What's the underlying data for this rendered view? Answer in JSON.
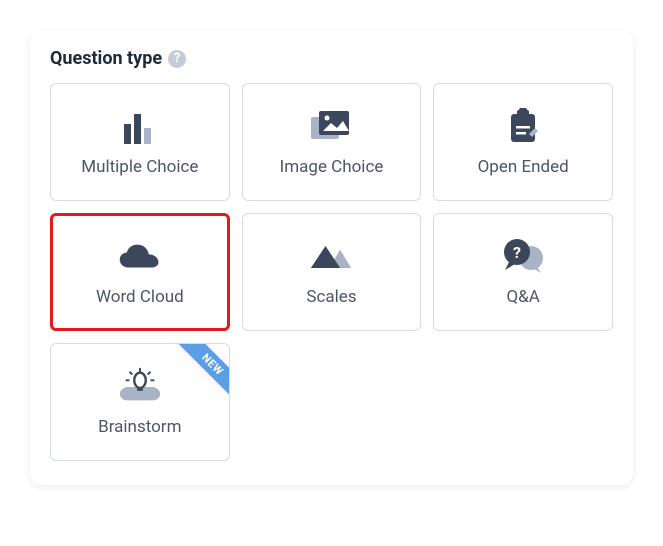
{
  "header": {
    "title": "Question type"
  },
  "cards": {
    "multiple_choice": {
      "label": "Multiple Choice"
    },
    "image_choice": {
      "label": "Image Choice"
    },
    "open_ended": {
      "label": "Open Ended"
    },
    "word_cloud": {
      "label": "Word Cloud"
    },
    "scales": {
      "label": "Scales"
    },
    "qa": {
      "label": "Q&A"
    },
    "brainstorm": {
      "label": "Brainstorm",
      "badge": "NEW"
    }
  },
  "colors": {
    "icon_dark": "#3c475b",
    "icon_light": "#a9b3c5",
    "selected_border": "#e11b1b",
    "badge_bg": "#5b9ee8"
  }
}
